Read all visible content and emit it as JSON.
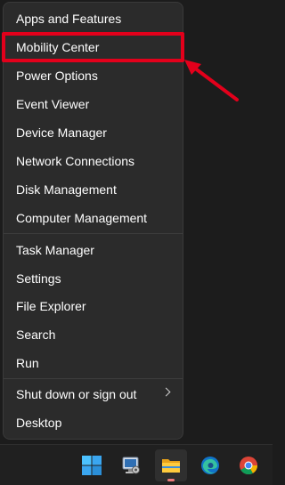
{
  "menu": {
    "items": [
      {
        "label": "Apps and Features"
      },
      {
        "label": "Mobility Center"
      },
      {
        "label": "Power Options"
      },
      {
        "label": "Event Viewer"
      },
      {
        "label": "Device Manager"
      },
      {
        "label": "Network Connections"
      },
      {
        "label": "Disk Management"
      },
      {
        "label": "Computer Management"
      },
      {
        "label": "Task Manager"
      },
      {
        "label": "Settings"
      },
      {
        "label": "File Explorer"
      },
      {
        "label": "Search"
      },
      {
        "label": "Run"
      },
      {
        "label": "Shut down or sign out"
      },
      {
        "label": "Desktop"
      }
    ]
  },
  "annotation": {
    "highlight_color": "#e3001b",
    "highlighted_item": "Mobility Center"
  },
  "taskbar": {
    "icons": [
      "start-icon",
      "admin-tool-icon",
      "file-explorer-icon",
      "edge-icon",
      "chrome-icon"
    ],
    "active_icon": "file-explorer-icon"
  }
}
